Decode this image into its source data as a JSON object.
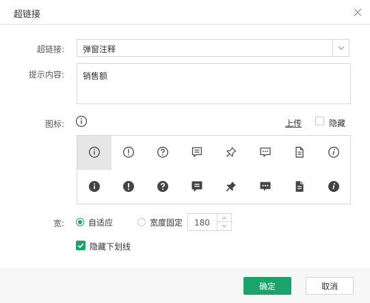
{
  "dialog": {
    "title": "超链接"
  },
  "form": {
    "hyperlink_label": "超链接:",
    "hyperlink_value": "弹窗注释",
    "tooltip_label": "提示内容:",
    "tooltip_value": "销售额",
    "icon_label": "图标:",
    "upload_label": "上传",
    "hide_label": "隐藏",
    "hide_checked": false,
    "width_label": "宽:",
    "width_options": [
      {
        "label": "自适应",
        "selected": true
      },
      {
        "label": "宽度固定",
        "selected": false
      }
    ],
    "width_value": "180",
    "hide_underline_label": "隐藏下划线",
    "hide_underline_checked": true
  },
  "icons": {
    "selected_index": 0,
    "outline": [
      "info-outline-icon",
      "exclamation-outline-icon",
      "question-outline-icon",
      "comment-outline-icon",
      "pin-outline-icon",
      "chat-dots-outline-icon",
      "document-outline-icon",
      "italic-info-outline-icon"
    ],
    "filled": [
      "info-filled-icon",
      "exclamation-filled-icon",
      "question-filled-icon",
      "comment-filled-icon",
      "pin-filled-icon",
      "chat-dots-filled-icon",
      "document-filled-icon",
      "italic-info-filled-icon"
    ]
  },
  "footer": {
    "ok_label": "确定",
    "cancel_label": "取消"
  },
  "colors": {
    "accent": "#1ca36a",
    "border": "#d5d5d5",
    "icon": "#444444"
  }
}
